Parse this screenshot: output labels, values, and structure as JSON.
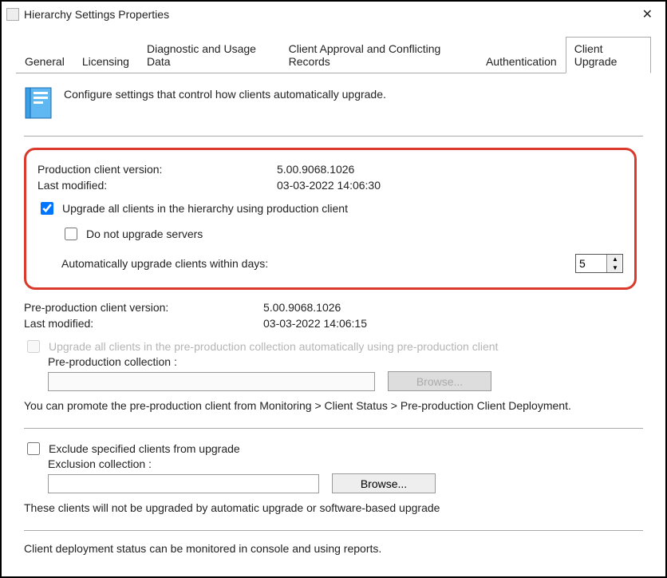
{
  "window": {
    "title": "Hierarchy Settings Properties",
    "close_glyph": "✕"
  },
  "tabs": {
    "general": "General",
    "licensing": "Licensing",
    "diagnostic": "Diagnostic and Usage Data",
    "approval": "Client Approval and Conflicting Records",
    "authentication": "Authentication",
    "upgrade": "Client Upgrade"
  },
  "header": {
    "description": "Configure settings that control how clients automatically upgrade."
  },
  "prod": {
    "version_label": "Production client version:",
    "version_value": "5.00.9068.1026",
    "modified_label": "Last modified:",
    "modified_value": "03-03-2022 14:06:30",
    "upgrade_all_label": "Upgrade all clients in the hierarchy using production client",
    "no_servers_label": "Do not upgrade servers",
    "auto_days_label": "Automatically upgrade clients within days:",
    "auto_days_value": "5"
  },
  "preprod": {
    "version_label": "Pre-production client version:",
    "version_value": "5.00.9068.1026",
    "modified_label": "Last modified:",
    "modified_value": "03-03-2022 14:06:15",
    "upgrade_all_label": "Upgrade all clients in the pre-production collection automatically using pre-production client",
    "collection_label": "Pre-production collection :",
    "browse_label": "Browse...",
    "help_text": "You can promote the pre-production client from Monitoring > Client Status > Pre-production Client Deployment."
  },
  "exclude": {
    "checkbox_label": "Exclude specified clients from upgrade",
    "collection_label": "Exclusion collection :",
    "browse_label": "Browse...",
    "help_text": "These clients will not be upgraded by automatic upgrade or software-based upgrade"
  },
  "footer": {
    "status_text": "Client deployment status can be monitored in console and using reports."
  },
  "glyph": {
    "up": "▲",
    "down": "▼"
  }
}
